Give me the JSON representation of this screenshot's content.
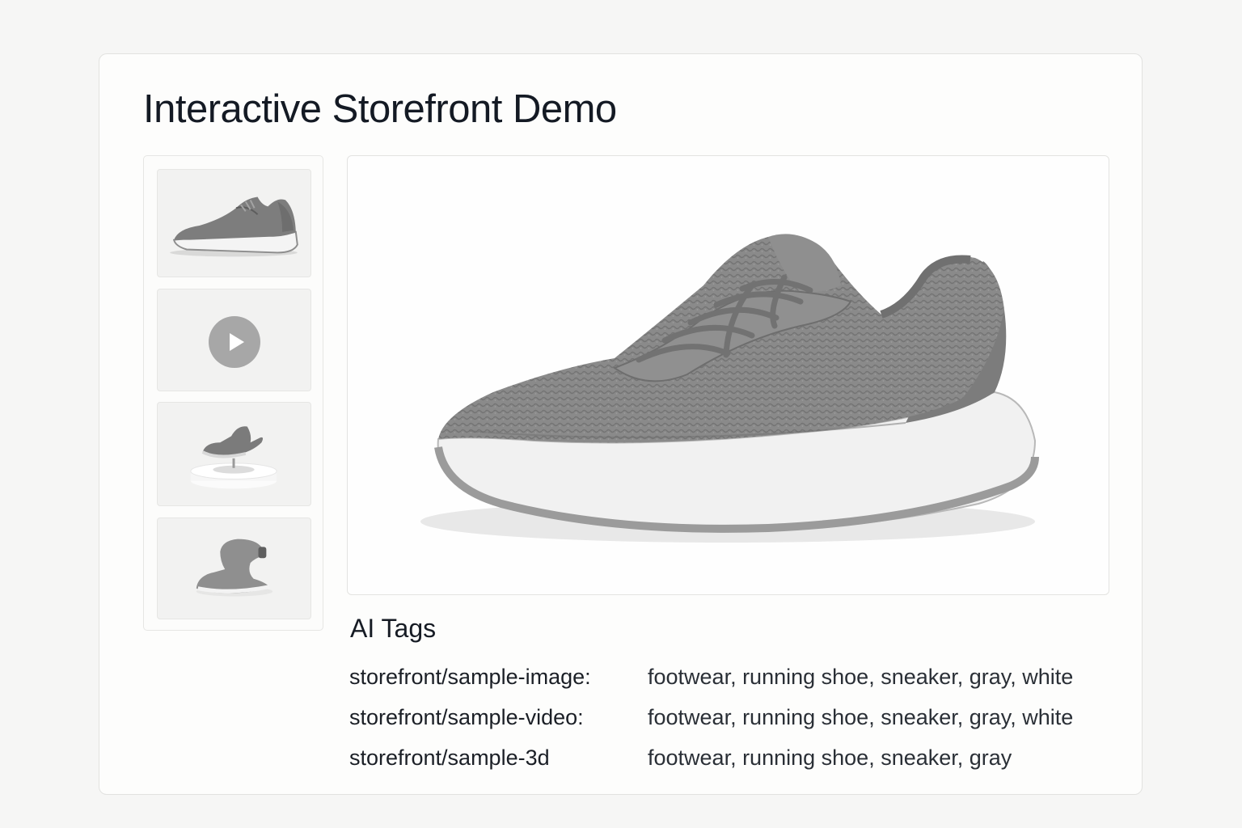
{
  "page": {
    "title": "Interactive Storefront Demo"
  },
  "gallery": {
    "thumbnails": [
      {
        "kind": "image",
        "icon": "shoe-side-icon"
      },
      {
        "kind": "video",
        "icon": "play-icon"
      },
      {
        "kind": "3d",
        "icon": "shoe-on-pedestal-icon"
      },
      {
        "kind": "3d-alt",
        "icon": "shoe-3d-model-icon"
      }
    ]
  },
  "viewer": {
    "icon": "running-shoe-icon"
  },
  "ai_tags": {
    "heading": "AI Tags",
    "rows": [
      {
        "key": "storefront/sample-image:",
        "value": "footwear, running shoe, sneaker, gray, white"
      },
      {
        "key": "storefront/sample-video:",
        "value": "footwear, running shoe, sneaker, gray, white"
      },
      {
        "key": "storefront/sample-3d",
        "value": "footwear, running shoe, sneaker, gray"
      }
    ]
  },
  "colors": {
    "background": "#f6f6f5",
    "card": "#fdfdfc",
    "shoe_gray": "#8a8a8a",
    "sole_white": "#ededed"
  }
}
